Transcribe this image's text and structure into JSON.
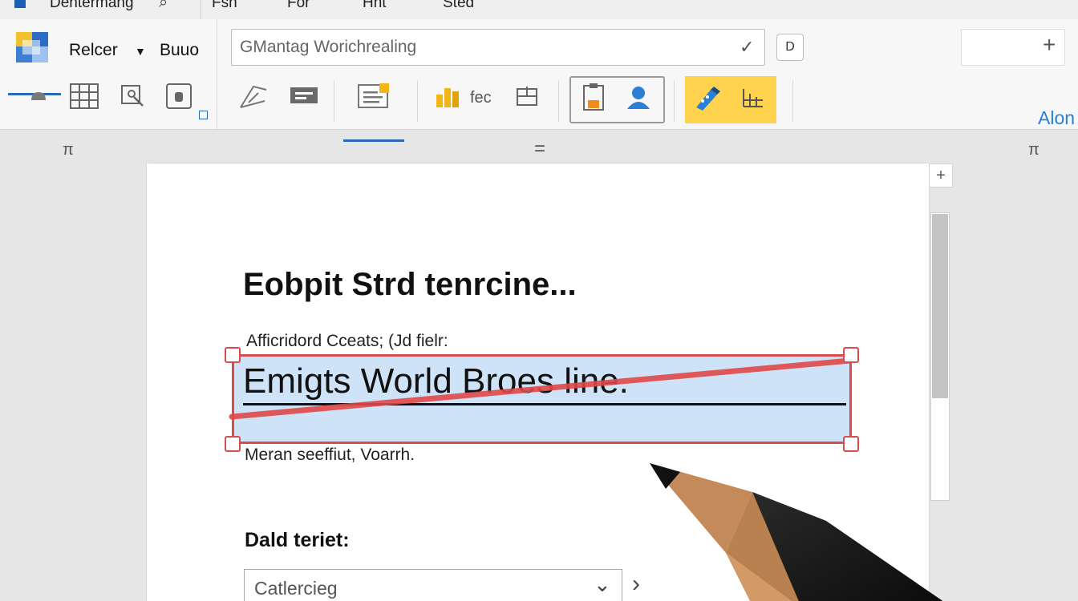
{
  "titlebar": {
    "app_title": "Dentermang",
    "tabs": [
      "Fsh",
      "For",
      "Hht",
      "Sted"
    ]
  },
  "ribbon": {
    "font_name": "Relcer",
    "font_size": "Buuo",
    "doc_name_value": "GMantag Worichrealing",
    "doc_icon": "D",
    "text_tool_label": "fec",
    "align_label": "Alon",
    "plus": "+"
  },
  "canvas": {
    "ruler_left": "π",
    "ruler_center": "=",
    "ruler_right": "π",
    "scroll_add": "+"
  },
  "document": {
    "heading": "Eobpit Strd tenrcine...",
    "caption": "Afficridord Cceats; (Jd fielr:",
    "selected_text": "Emigts World Broes line.",
    "after_text": "Meran seeffiut, Voarrh.",
    "field_label": "Dald teriet:",
    "dropdown_value": "Catlercieg",
    "dropdown_chevron": "⌄",
    "next_arrow": "›"
  },
  "colors": {
    "accent_blue": "#2a6ab8",
    "selection_fill": "#cfe3f8",
    "markup_red": "#d94c4c",
    "highlight_yellow": "#ffd34d"
  }
}
